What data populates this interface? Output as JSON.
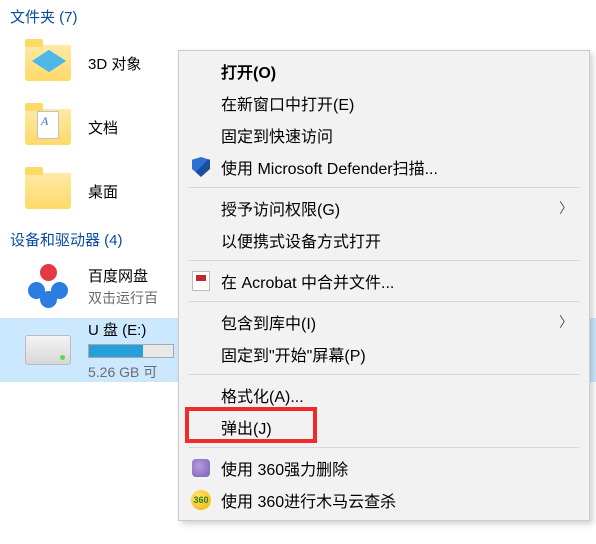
{
  "sections": {
    "folders_header": "文件夹 (7)",
    "devices_header": "设备和驱动器 (4)"
  },
  "items": {
    "objects3d": "3D 对象",
    "documents": "文档",
    "desktop": "桌面",
    "baidu_name": "百度网盘",
    "baidu_sub": "双击运行百",
    "udisk_name": "U 盘 (E:)",
    "udisk_sub": "5.26 GB 可",
    "udisk_fill_percent": 64
  },
  "menu": {
    "open": "打开(O)",
    "open_new_window": "在新窗口中打开(E)",
    "pin_quick": "固定到快速访问",
    "defender": "使用 Microsoft Defender扫描...",
    "grant_access": "授予访问权限(G)",
    "portable": "以便携式设备方式打开",
    "acrobat": "在 Acrobat 中合并文件...",
    "include_lib": "包含到库中(I)",
    "pin_start": "固定到\"开始\"屏幕(P)",
    "format": "格式化(A)...",
    "eject": "弹出(J)",
    "del360": "使用 360强力删除",
    "scan360": "使用 360进行木马云查杀"
  }
}
